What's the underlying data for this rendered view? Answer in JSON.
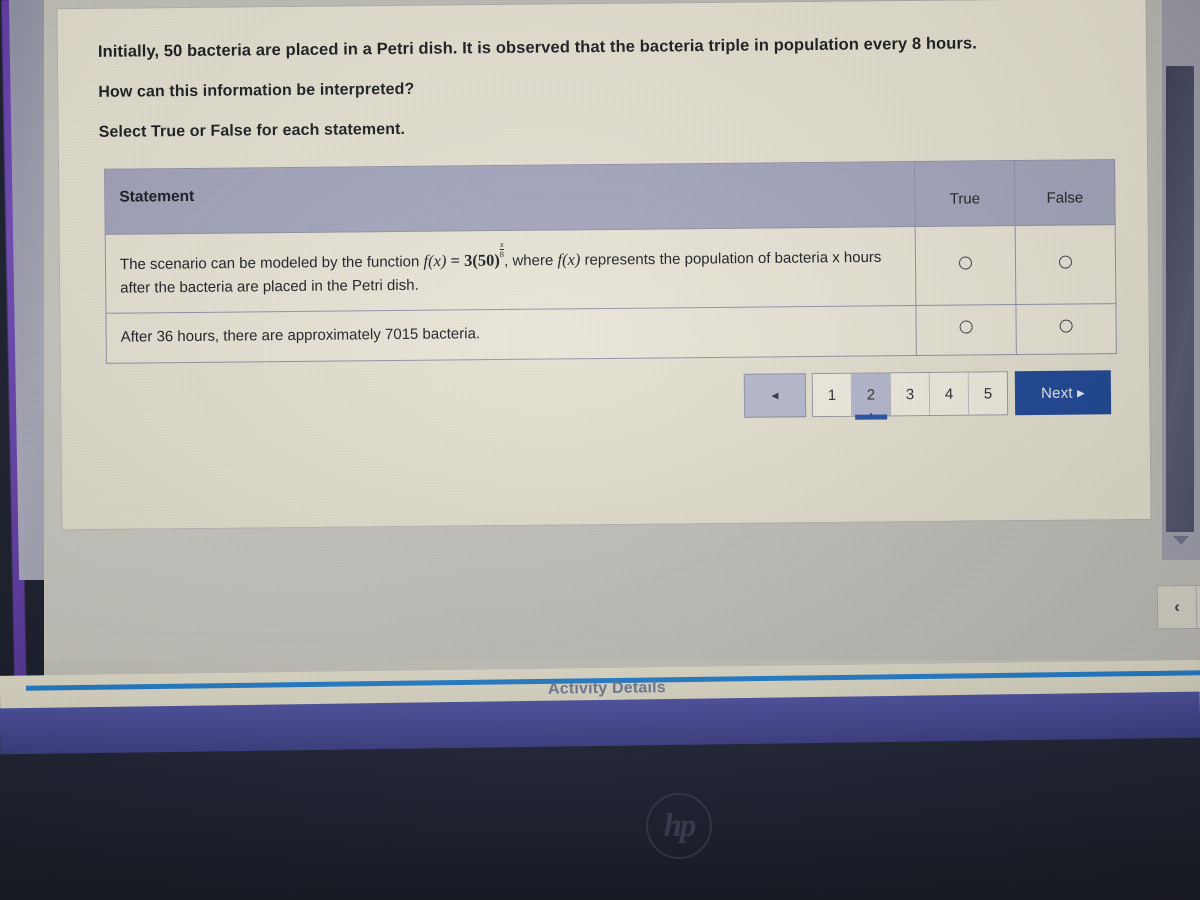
{
  "question": {
    "prompt_line1": "Initially, 50 bacteria are placed in a Petri dish. It is observed that the bacteria triple in population every 8 hours.",
    "prompt_line2": "How can this information be interpreted?",
    "instruction": "Select True or False for each statement."
  },
  "table": {
    "headers": {
      "statement": "Statement",
      "true": "True",
      "false": "False"
    },
    "rows": [
      {
        "statement_before": "The scenario can be modeled by the function ",
        "formula_f": "f",
        "formula_x1": "(x)",
        "formula_eq": " = 3(50)",
        "exponent_numerator": "x",
        "exponent_denominator": "8",
        "statement_mid": ", where ",
        "formula_f2": "f",
        "formula_x2": "(x)",
        "statement_after": " represents the population of bacteria x hours after the bacteria are placed in the Petri dish.",
        "true_selected": false,
        "false_selected": false
      },
      {
        "statement_plain": "After 36 hours, there are approximately 7015 bacteria.",
        "true_selected": false,
        "false_selected": false
      }
    ]
  },
  "pagination": {
    "prev_icon": "left-triangle-icon",
    "prev_glyph": "◀",
    "pages": [
      "1",
      "2",
      "3",
      "4",
      "5"
    ],
    "active_page": "2",
    "next_label": "Next ▸"
  },
  "nav": {
    "prev_glyph": "‹",
    "next_glyph": "›"
  },
  "scrollbar": {
    "down_arrow_icon": "scroll-down-arrow-icon"
  },
  "footer": {
    "activity_details": "Activity Details"
  },
  "device": {
    "brand_logo": "hp"
  },
  "colors": {
    "header_bg": "#a6a9c6",
    "row_bg": "#eeebe0",
    "next_button": "#17439a",
    "active_page_bg": "#b6b9d6",
    "active_page_underline": "#1f4fa8",
    "blue_rule": "#1f7fd6",
    "activity_text": "#6e7a9a",
    "violet_edge": "#6a3fc0"
  }
}
